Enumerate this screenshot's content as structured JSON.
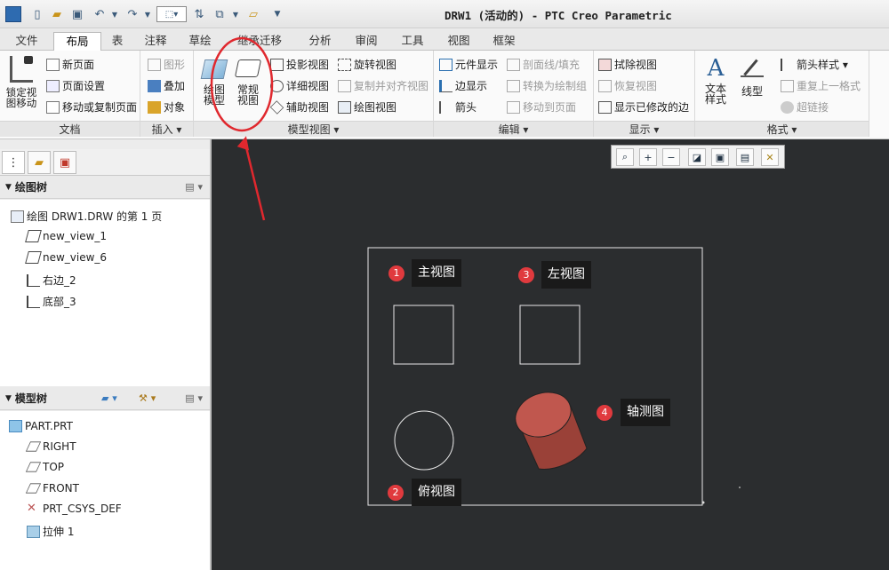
{
  "window": {
    "title": "DRW1 (活动的) - PTC Creo Parametric"
  },
  "tabs": [
    "文件",
    "布局",
    "表",
    "注释",
    "草绘",
    "继承迁移",
    "分析",
    "审阅",
    "工具",
    "视图",
    "框架"
  ],
  "active_tab": "布局",
  "ribbon": {
    "doc": {
      "lock": "锁定视图移动",
      "new_page": "新页面",
      "page_setup": "页面设置",
      "move_copy": "移动或复制页面",
      "label": "文档"
    },
    "insert": {
      "graphic": "图形",
      "overlay": "叠加",
      "object": "对象",
      "label": "插入"
    },
    "model_views": {
      "drawing_model": "绘图模型",
      "general_view": "常规视图",
      "projection": "投影视图",
      "detailed": "详细视图",
      "auxiliary": "辅助视图",
      "revolved": "旋转视图",
      "copy_align": "复制并对齐视图",
      "drawing_view": "绘图视图",
      "label": "模型视图"
    },
    "edit": {
      "element_display": "元件显示",
      "section_line": "剖面线/填充",
      "edge_display": "边显示",
      "convert": "转换为绘制组",
      "arrow": "箭头",
      "move_to_page": "移动到页面",
      "label": "编辑"
    },
    "display": {
      "erase": "拭除视图",
      "restore": "恢复视图",
      "show_modified": "显示已修改的边",
      "label": "显示"
    },
    "format": {
      "text_style": "文本样式",
      "line_style": "线型",
      "arrow_style": "箭头样式",
      "repeat": "重复上一格式",
      "hyperlink": "超链接",
      "label": "格式"
    }
  },
  "drawing_tree": {
    "title": "绘图树",
    "items": [
      "绘图 DRW1.DRW 的第 1 页",
      "new_view_1",
      "new_view_6",
      "右边_2",
      "底部_3"
    ]
  },
  "model_tree": {
    "title": "模型树",
    "items": [
      "PART.PRT",
      "RIGHT",
      "TOP",
      "FRONT",
      "PRT_CSYS_DEF",
      "拉伸 1"
    ]
  },
  "annotations": [
    {
      "num": "1",
      "label": "主视图"
    },
    {
      "num": "2",
      "label": "俯视图"
    },
    {
      "num": "3",
      "label": "左视图"
    },
    {
      "num": "4",
      "label": "轴测图"
    }
  ],
  "colors": {
    "canvas": "#2b2d2f",
    "highlight": "#e0282e",
    "solid": "#c0574e"
  }
}
